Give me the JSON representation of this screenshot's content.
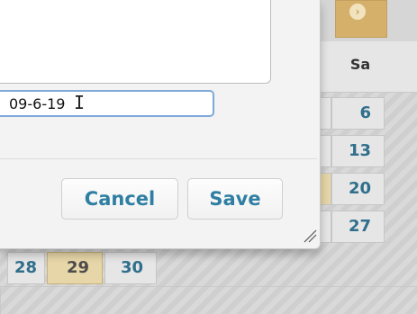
{
  "calendar": {
    "weekday_header_sa": "Sa",
    "next_icon": "right-arrow-icon",
    "days": {
      "d6": "6",
      "d13": "13",
      "d20": "20",
      "d27": "27",
      "d28": "28",
      "d29": "29",
      "d30": "30"
    }
  },
  "dialog": {
    "date_value": "09-6-19",
    "cancel_label": "Cancel",
    "save_label": "Save",
    "resize_icon": "resize-grip-icon"
  },
  "colors": {
    "accent_text": "#2f7fa3",
    "today_bg": "#e7d6a8",
    "nav_button": "#d4b06a"
  }
}
